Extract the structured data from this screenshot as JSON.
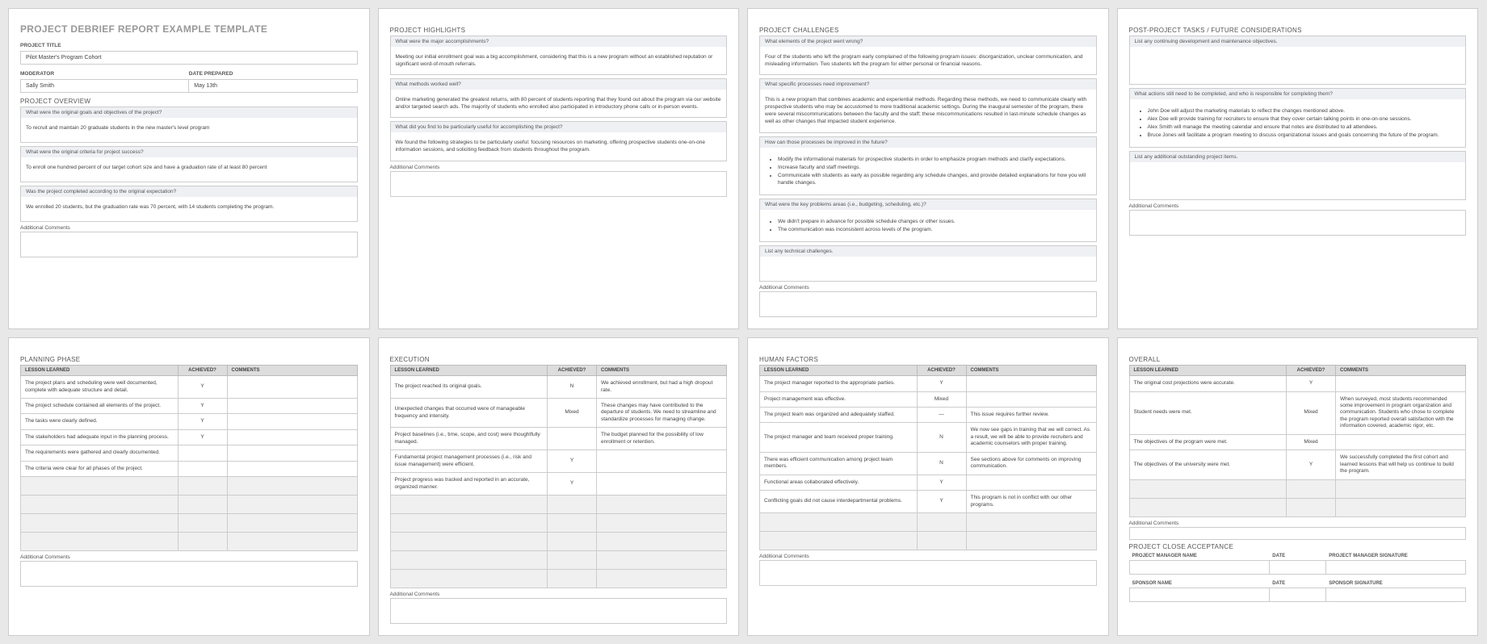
{
  "page1": {
    "main_title": "PROJECT DEBRIEF REPORT EXAMPLE TEMPLATE",
    "project_title_label": "PROJECT TITLE",
    "project_title": "Pilot Master's Program Cohort",
    "moderator_label": "MODERATOR",
    "moderator": "Sally Smith",
    "date_prepared_label": "DATE PREPARED",
    "date_prepared": "May 13th",
    "overview_title": "PROJECT OVERVIEW",
    "q1": "What were the original goals and objectives of the project?",
    "a1": "To recruit and maintain 20 graduate students in the new master's level program",
    "q2": "What were the original criteria for project success?",
    "a2": "To enroll one hundred percent of our target cohort size and have a graduation rate of at least 80 percent",
    "q3": "Was the project completed according to the original expectation?",
    "a3": "We enrolled 20 students, but the graduation rate was 70 percent, with 14 students completing the program.",
    "ac": "Additional Comments"
  },
  "page2": {
    "title": "PROJECT HIGHLIGHTS",
    "q1": "What were the major accomplishments?",
    "a1": "Meeting our initial enrollment goal was a big accomplishment, considering that this is a new program without an established reputation or significant word-of-mouth referrals.",
    "q2": "What methods worked well?",
    "a2": "Online marketing generated the greatest returns, with 80 percent of students reporting that they found out about the program via our website and/or targeted search ads. The majority of students who enrolled also participated in introductory phone calls or in-person events.",
    "q3": "What did you find to be particularly useful for accomplishing the project?",
    "a3": "We found the following strategies to be particularly useful: focusing resources on marketing, offering prospective students one-on-one information sessions, and soliciting feedback from students throughout the program.",
    "ac": "Additional Comments"
  },
  "page3": {
    "title": "PROJECT CHALLENGES",
    "q1": "What elements of the project went wrong?",
    "a1": "Four of the students who left the program early complained of the following program issues: disorganization, unclear communication, and misleading information. Two students left the program for either personal or financial reasons.",
    "q2": "What specific processes need improvement?",
    "a2": "This is a new program that combines academic and experiential methods. Regarding these methods, we need to communicate clearly with prospective students who may be accustomed to more traditional academic settings. During the inaugural semester of the program, there were several miscommunications between the faculty and the staff; these miscommunications resulted in last-minute schedule changes as well as other changes that impacted student experience.",
    "q3": "How can those processes be improved in the future?",
    "b1": "Modify the informational materials for prospective students in order to emphasize program methods and clarify expectations.",
    "b2": "Increase faculty and staff meetings.",
    "b3": "Communicate with students as early as possible regarding any schedule changes, and provide detailed explanations for how you will handle changes.",
    "q4": "What were the key problems areas (i.e., budgeting, scheduling, etc.)?",
    "b4": "We didn't prepare in advance for possible schedule changes or other issues.",
    "b5": "The communication was inconsistent across levels of the program.",
    "q5": "List any technical challenges.",
    "ac": "Additional Comments"
  },
  "page4": {
    "title": "POST-PROJECT TASKS / FUTURE CONSIDERATIONS",
    "q1": "List any continuing development and maintenance objectives.",
    "q2": "What actions still need to be completed, and who is responsible for completing them?",
    "b1": "John Doe will adjust the marketing materials to reflect the changes mentioned above.",
    "b2": "Alex Doe will provide training for recruiters to ensure that they cover certain talking points in one-on-one sessions.",
    "b3": "Alex Smith will manage the meeting calendar and ensure that notes are distributed to all attendees.",
    "b4": "Bruce Jones will facilitate a program meeting to discuss organizational issues and goals concerning the future of the program.",
    "q3": "List any additional outstanding project items.",
    "ac": "Additional Comments"
  },
  "lessons_headers": {
    "lesson": "LESSON LEARNED",
    "achieved": "ACHIEVED?",
    "comments": "COMMENTS"
  },
  "page5": {
    "title": "PLANNING PHASE",
    "rows": [
      {
        "l": "The project plans and scheduling were well documented, complete with adequate structure and detail.",
        "a": "Y",
        "c": ""
      },
      {
        "l": "The project schedule contained all elements of the project.",
        "a": "Y",
        "c": ""
      },
      {
        "l": "The tasks were clearly defined.",
        "a": "Y",
        "c": ""
      },
      {
        "l": "The stakeholders had adequate input in the planning process.",
        "a": "Y",
        "c": ""
      },
      {
        "l": "The requirements were gathered and clearly documented.",
        "a": "",
        "c": ""
      },
      {
        "l": "The criteria were clear for all phases of the project.",
        "a": "",
        "c": ""
      }
    ],
    "ac": "Additional Comments"
  },
  "page6": {
    "title": "EXECUTION",
    "rows": [
      {
        "l": "The project reached its original goals.",
        "a": "N",
        "c": "We achieved enrollment, but had a high dropout rate."
      },
      {
        "l": "Unexpected changes that occurred were of manageable frequency and intensity.",
        "a": "Mixed",
        "c": "These changes may have contributed to the departure of students. We need to streamline and standardize processes for managing change."
      },
      {
        "l": "Project baselines (i.e., time, scope, and cost) were thoughtfully managed.",
        "a": "",
        "c": "The budget planned for the possibility of low enrollment or retention."
      },
      {
        "l": "Fundamental project management processes (i.e., risk and issue management) were efficient.",
        "a": "Y",
        "c": ""
      },
      {
        "l": "Project progress was tracked and reported in an accurate, organized manner.",
        "a": "Y",
        "c": ""
      }
    ],
    "ac": "Additional Comments"
  },
  "page7": {
    "title": "HUMAN FACTORS",
    "rows": [
      {
        "l": "The project manager reported to the appropriate parties.",
        "a": "Y",
        "c": ""
      },
      {
        "l": "Project management was effective.",
        "a": "Mixed",
        "c": ""
      },
      {
        "l": "The project team was organized and adequately staffed.",
        "a": "—",
        "c": "This issue requires further review."
      },
      {
        "l": "The project manager and team received proper training.",
        "a": "N",
        "c": "We now see gaps in training that we will correct. As a result, we will be able to provide recruiters and academic counselors with proper training."
      },
      {
        "l": "There was efficient communication among project team members.",
        "a": "N",
        "c": "See sections above for comments on improving communication."
      },
      {
        "l": "Functional areas collaborated effectively.",
        "a": "Y",
        "c": ""
      },
      {
        "l": "Conflicting goals did not cause interdepartmental problems.",
        "a": "Y",
        "c": "This program is not in conflict with our other programs."
      }
    ],
    "ac": "Additional Comments"
  },
  "page8": {
    "title": "OVERALL",
    "rows": [
      {
        "l": "The original cost projections were accurate.",
        "a": "Y",
        "c": ""
      },
      {
        "l": "Student needs were met.",
        "a": "Mixed",
        "c": "When surveyed, most students recommended some improvement in program organization and communication. Students who chose to complete the program reported overall satisfaction with the information covered, academic rigor, etc."
      },
      {
        "l": "The objectives of the program were met.",
        "a": "Mixed",
        "c": ""
      },
      {
        "l": "The objectives of the university were met.",
        "a": "Y",
        "c": "We successfully completed the first cohort and learned lessons that will help us continue to build the program."
      }
    ],
    "ac": "Additional Comments",
    "close_title": "PROJECT CLOSE ACCEPTANCE",
    "pm_name": "PROJECT MANAGER NAME",
    "date": "DATE",
    "pm_sig": "PROJECT MANAGER SIGNATURE",
    "sp_name": "SPONSOR NAME",
    "sp_sig": "SPONSOR SIGNATURE"
  }
}
